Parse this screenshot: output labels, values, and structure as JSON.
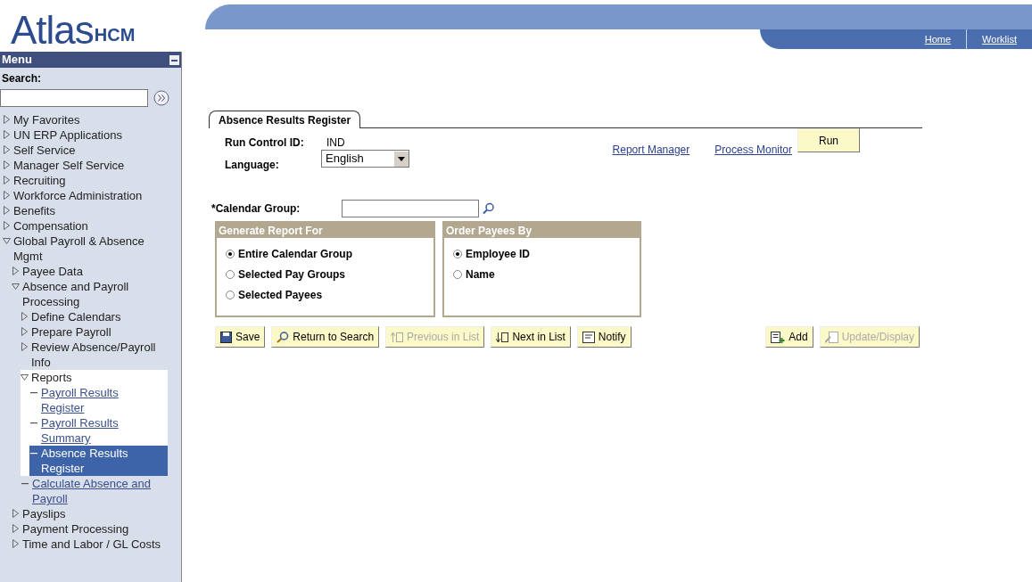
{
  "header": {
    "logo": "Atlas",
    "logo_suffix": "HCM",
    "nav_links": [
      "Home",
      "Worklist"
    ]
  },
  "sidebar": {
    "title": "Menu",
    "search_label": "Search:",
    "items": [
      {
        "label": "My Favorites",
        "kind": "folder",
        "expanded": false
      },
      {
        "label": "UN ERP Applications",
        "kind": "folder",
        "expanded": false
      },
      {
        "label": "Self Service",
        "kind": "folder",
        "expanded": false
      },
      {
        "label": "Manager Self Service",
        "kind": "folder",
        "expanded": false
      },
      {
        "label": "Recruiting",
        "kind": "folder",
        "expanded": false
      },
      {
        "label": "Workforce Administration",
        "kind": "folder",
        "expanded": false
      },
      {
        "label": "Benefits",
        "kind": "folder",
        "expanded": false
      },
      {
        "label": "Compensation",
        "kind": "folder",
        "expanded": false
      },
      {
        "label": "Global Payroll & Absence Mgmt",
        "kind": "folder",
        "expanded": true,
        "current": false,
        "children": [
          {
            "label": "Payee Data",
            "kind": "folder",
            "expanded": false
          },
          {
            "label": "Absence and Payroll Processing",
            "kind": "folder",
            "expanded": true,
            "current": false,
            "children": [
              {
                "label": "Define Calendars",
                "kind": "folder",
                "expanded": false
              },
              {
                "label": "Prepare Payroll",
                "kind": "folder",
                "expanded": false
              },
              {
                "label": "Review Absence/Payroll Info",
                "kind": "folder",
                "expanded": false
              },
              {
                "label": "Reports",
                "kind": "folder",
                "expanded": true,
                "current": true,
                "children": [
                  {
                    "label": "Payroll Results Register",
                    "kind": "link",
                    "selected": false
                  },
                  {
                    "label": "Payroll Results Summary",
                    "kind": "link",
                    "selected": false
                  },
                  {
                    "label": "Absence Results Register",
                    "kind": "link",
                    "selected": true
                  }
                ]
              },
              {
                "label": "Calculate Absence and Payroll",
                "kind": "link",
                "selected": false
              }
            ]
          },
          {
            "label": "Payslips",
            "kind": "folder",
            "expanded": false
          },
          {
            "label": "Payment Processing",
            "kind": "folder",
            "expanded": false
          },
          {
            "label": "Time and Labor / GL Costs",
            "kind": "folder",
            "expanded": false
          }
        ]
      }
    ]
  },
  "page": {
    "tab": "Absence Results Register",
    "run_control_label": "Run Control ID:",
    "run_control_value": "IND",
    "language_label": "Language:",
    "language_value": "English",
    "links": [
      "Report Manager",
      "Process Monitor"
    ],
    "run_button": "Run",
    "calendar_group_label": "*Calendar Group:",
    "groups": [
      {
        "title": "Generate Report For",
        "options": [
          {
            "label": "Entire Calendar Group",
            "selected": true
          },
          {
            "label": "Selected Pay Groups",
            "selected": false
          },
          {
            "label": "Selected Payees",
            "selected": false
          }
        ]
      },
      {
        "title": "Order Payees By",
        "options": [
          {
            "label": "Employee ID",
            "selected": true
          },
          {
            "label": "Name",
            "selected": false
          }
        ]
      }
    ],
    "toolbar_left": [
      {
        "label": "Save",
        "kind": "save",
        "disabled": false
      },
      {
        "label": "Return to Search",
        "kind": "search",
        "disabled": false
      },
      {
        "label": "Previous in List",
        "kind": "prev",
        "disabled": true
      },
      {
        "label": "Next in List",
        "kind": "next",
        "disabled": false
      },
      {
        "label": "Notify",
        "kind": "notify",
        "disabled": false
      }
    ],
    "toolbar_right": [
      {
        "label": "Add",
        "kind": "add",
        "disabled": false
      },
      {
        "label": "Update/Display",
        "kind": "update",
        "disabled": true
      }
    ]
  }
}
